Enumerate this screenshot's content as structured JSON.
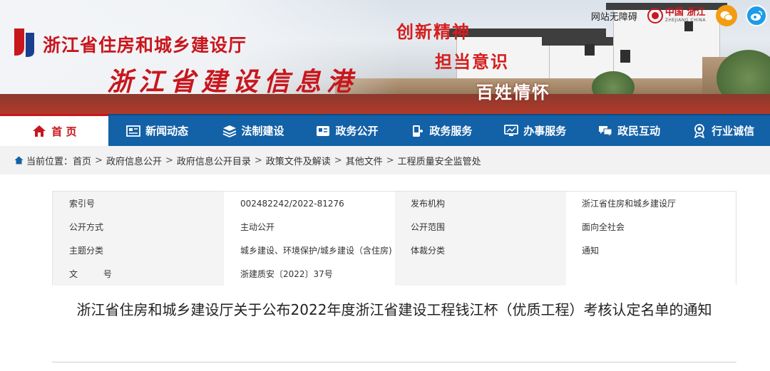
{
  "header": {
    "site_title": "浙江省住房和城乡建设厅",
    "site_subtitle": "浙江省建设信息港",
    "slogans": [
      "创新精神",
      "担当意识",
      "百姓情怀"
    ],
    "accessibility_link": "网站无障碍",
    "zj_logo_cn": "中国 浙江",
    "zj_logo_en": "ZHEJIANG CHINA",
    "brand_color": "#c8161d"
  },
  "nav": {
    "items": [
      {
        "label": "首 页",
        "icon": "home-icon"
      },
      {
        "label": "新闻动态",
        "icon": "newspaper-icon"
      },
      {
        "label": "法制建设",
        "icon": "layers-icon"
      },
      {
        "label": "政务公开",
        "icon": "document-icon"
      },
      {
        "label": "政务服务",
        "icon": "phone-service-icon"
      },
      {
        "label": "办事服务",
        "icon": "monitor-icon"
      },
      {
        "label": "政民互动",
        "icon": "chat-icon"
      },
      {
        "label": "行业诚信",
        "icon": "badge-icon"
      }
    ],
    "bar_color": "#1361a7"
  },
  "breadcrumb": {
    "prefix": "当前位置：",
    "items": [
      "首页",
      "政府信息公开",
      "政府信息公开目录",
      "政策文件及解读",
      "其他文件",
      "工程质量安全监管处"
    ],
    "separator": ">"
  },
  "info": {
    "index_no_label": "索引号",
    "index_no": "002482242/2022-81276",
    "publisher_label": "发布机构",
    "publisher": "浙江省住房和城乡建设厅",
    "open_mode_label": "公开方式",
    "open_mode": "主动公开",
    "open_scope_label": "公开范围",
    "open_scope": "面向全社会",
    "topic_label": "主题分类",
    "topic": "城乡建设、环境保护/城乡建设（含住房)",
    "genre_label": "体裁分类",
    "genre": "通知",
    "doc_no_label": "文 号",
    "doc_no": "浙建质安〔2022〕37号"
  },
  "document": {
    "title": "浙江省住房和城乡建设厅关于公布2022年度浙江省建设工程钱江杯（优质工程）考核认定名单的通知"
  }
}
